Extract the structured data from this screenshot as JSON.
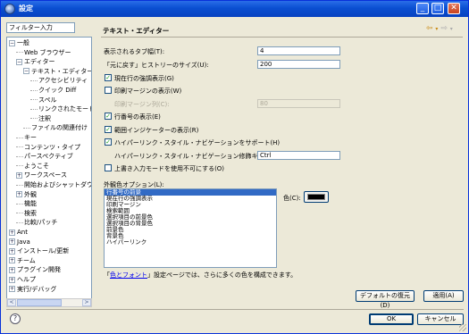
{
  "window": {
    "title": "設定",
    "min_glyph": "_",
    "max_glyph": "□",
    "close_glyph": "✕"
  },
  "filter": {
    "value": "フィルター入力"
  },
  "tree": {
    "items": [
      {
        "label": "一般",
        "toggle": "−",
        "depth": 0
      },
      {
        "label": "Web ブラウザー",
        "toggle": "",
        "depth": 1
      },
      {
        "label": "エディター",
        "toggle": "−",
        "depth": 1
      },
      {
        "label": "テキスト・エディター",
        "toggle": "−",
        "depth": 2
      },
      {
        "label": "アクセシビリティ",
        "toggle": "",
        "depth": 3
      },
      {
        "label": "クイック Diff",
        "toggle": "",
        "depth": 3
      },
      {
        "label": "スペル",
        "toggle": "",
        "depth": 3
      },
      {
        "label": "リンクされたモード",
        "toggle": "",
        "depth": 3
      },
      {
        "label": "注釈",
        "toggle": "",
        "depth": 3
      },
      {
        "label": "ファイルの関連付け",
        "toggle": "",
        "depth": 2
      },
      {
        "label": "キー",
        "toggle": "",
        "depth": 1
      },
      {
        "label": "コンテンツ・タイプ",
        "toggle": "",
        "depth": 1
      },
      {
        "label": "パースペクティブ",
        "toggle": "",
        "depth": 1
      },
      {
        "label": "ようこそ",
        "toggle": "",
        "depth": 1
      },
      {
        "label": "ワークスペース",
        "toggle": "+",
        "depth": 1
      },
      {
        "label": "開始およびシャットダウン",
        "toggle": "",
        "depth": 1
      },
      {
        "label": "外観",
        "toggle": "+",
        "depth": 1
      },
      {
        "label": "機能",
        "toggle": "",
        "depth": 1
      },
      {
        "label": "検索",
        "toggle": "",
        "depth": 1
      },
      {
        "label": "比較/パッチ",
        "toggle": "",
        "depth": 1
      },
      {
        "label": "Ant",
        "toggle": "+",
        "depth": 0
      },
      {
        "label": "Java",
        "toggle": "+",
        "depth": 0
      },
      {
        "label": "インストール/更新",
        "toggle": "+",
        "depth": 0
      },
      {
        "label": "チーム",
        "toggle": "+",
        "depth": 0
      },
      {
        "label": "プラグイン開発",
        "toggle": "+",
        "depth": 0
      },
      {
        "label": "ヘルプ",
        "toggle": "+",
        "depth": 0
      },
      {
        "label": "実行/デバッグ",
        "toggle": "+",
        "depth": 0
      }
    ],
    "scroll_left": "<",
    "scroll_right": ">"
  },
  "page": {
    "title": "テキスト・エディター",
    "nav_back": "⇦",
    "nav_forward": "⇨",
    "nav_dropdown": "▾",
    "tab_width_label": "表示されるタブ幅(T):",
    "tab_width_value": "4",
    "undo_history_label": "「元に戻す」ヒストリーのサイズ(U):",
    "undo_history_value": "200",
    "highlight_current_line": "現在行の強調表示(G)",
    "show_print_margin": "印刷マージンの表示(W)",
    "print_margin_col_label": "印刷マージン列(C):",
    "print_margin_col_value": "80",
    "show_line_numbers": "行番号の表示(E)",
    "show_range_indicator": "範囲インジケーターの表示(R)",
    "hyperlink_nav": "ハイパーリンク・スタイル・ナビゲーションをサポート(H)",
    "hyperlink_modifier_label": "ハイパーリンク・スタイル・ナビゲーション修飾キー(M):",
    "hyperlink_modifier_value": "Ctrl",
    "disable_overwrite": "上書き入力モードを使用不可にする(O)",
    "appearance_options_label": "外観色オプション(L):",
    "appearance_items": [
      "行番号の前景",
      "現在行の強調表示",
      "印刷マージン",
      "検索範囲",
      "選択項目の前景色",
      "選択項目の背景色",
      "前景色",
      "背景色",
      "ハイパーリンク"
    ],
    "color_label": "色(C):",
    "link_prefix": "「",
    "link_text": "色とフォント",
    "link_suffix": "」設定ページでは、さらに多くの色を構成できます。",
    "restore_defaults": "デフォルトの復元(D)",
    "apply": "適用(A)"
  },
  "footer": {
    "help_glyph": "?",
    "ok": "OK",
    "cancel": "キャンセル"
  },
  "colors": {
    "selection": "#316ac5",
    "swatch": "#000000"
  }
}
